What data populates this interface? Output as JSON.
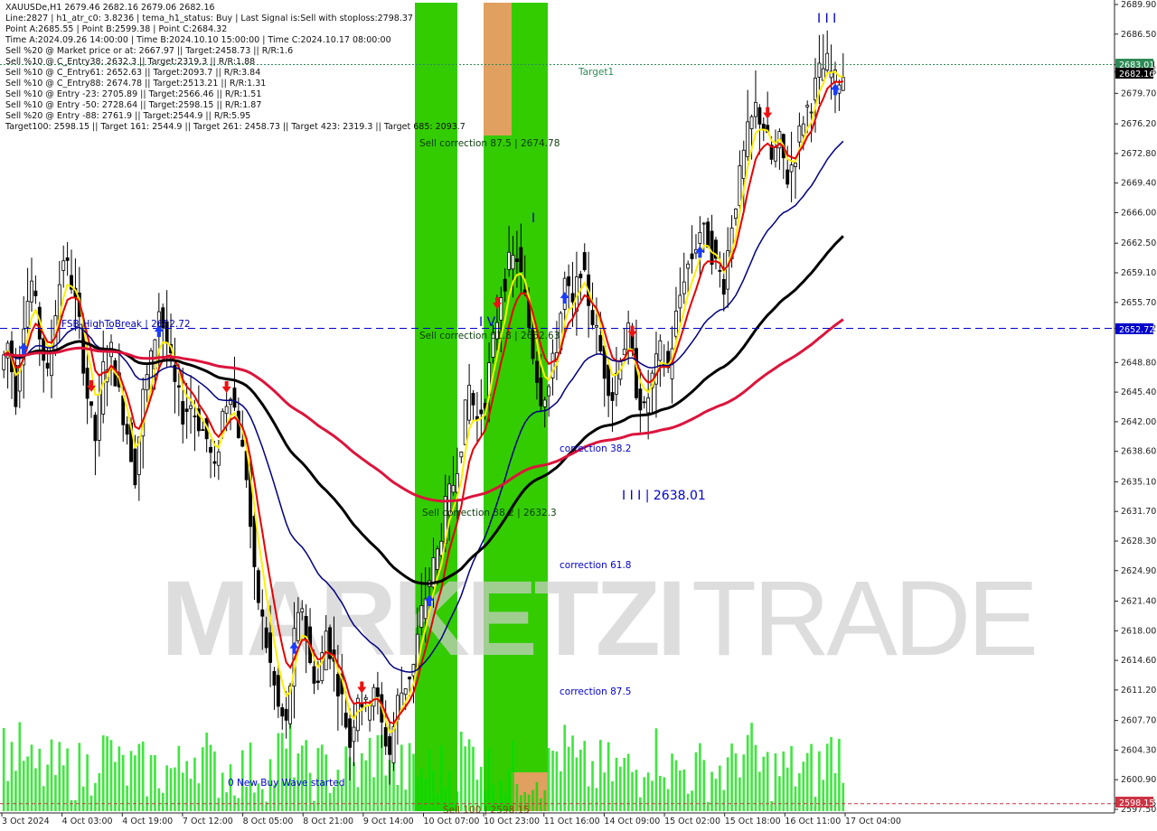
{
  "header": {
    "lines": [
      "XAUUSDe,H1  2679.46 2682.16 2679.06 2682.16",
      "Line:2827 | h1_atr_c0: 3.8236 | tema_h1_status: Buy | Last Signal is:Sell with stoploss:2798.37",
      "Point A:2685.55 | Point B:2599.38 | Point C:2684.32",
      "Time A:2024.09.26 14:00:00 | Time B:2024.10.10 15:00:00 | Time C:2024.10.17 08:00:00",
      "Sell %20 @ Market price or at: 2667.97 || Target:2458.73 || R/R:1.6",
      "Sell %10 @ C_Entry38: 2632.3 || Target:2319.3 || R/R:1.88",
      "Sell %10 @ C_Entry61: 2652.63 || Target:2093.7 || R/R:3.84",
      "Sell %10 @ C_Entry88: 2674.78 || Target:2513.21 || R/R:1.31",
      "Sell %10 @ Entry -23: 2705.89 || Target:2566.46 || R/R:1.51",
      "Sell %10 @ Entry -50: 2728.64 || Target:2598.15 || R/R:1.87",
      "Sell %20 @ Entry -88: 2761.9 || Target:2544.9 || R/R:5.95",
      "Target100: 2598.15 || Target 161: 2544.9 || Target 261: 2458.73 || Target 423: 2319.3 || Target 685: 2093.7"
    ]
  },
  "watermark": {
    "bold": "MARKETZI",
    "light": "TRADE"
  },
  "annotations": {
    "target1": "Target1",
    "sell_875": "Sell correction 87.5 | 2674.78",
    "sell_618": "Sell correction 61.8 | 2652.63",
    "sell_382": "Sell correction 38.2 | 2632.3",
    "sell_100": "Sell 100 | 2598.15",
    "fsb": "FSB-HighToBreak | 2652.72",
    "corr_382": "correction 38.2",
    "corr_618": "correction 61.8",
    "corr_875": "correction 87.5",
    "wave": "0 New Buy Wave started",
    "iii_2638": "I I I | 2638.01",
    "wave_iv": "I V",
    "wave_i": "I",
    "wave_iii_top": "I I I"
  },
  "price_tags": {
    "current": "2682.16",
    "target1": "2683.01",
    "fsb": "2652.72",
    "sell100": "2598.15"
  },
  "colors": {
    "green_zone": "#33cc00",
    "orange_zone": "#e0a060",
    "ema_red": "#e60000",
    "ema_yellow": "#ffee00",
    "ma_navy": "#000080",
    "ma_black": "#000000",
    "ma_crimson": "#dc143c",
    "target_line": "#2e8b57",
    "fsb_line": "#0000cc",
    "sell100_line": "#cc3344",
    "volume": "#00dd00"
  },
  "chart_data": {
    "type": "candlestick",
    "symbol": "XAUUSDe",
    "timeframe": "H1",
    "ylim": [
      2597.5,
      2689.9
    ],
    "y_ticks": [
      "2689.90",
      "2686.50",
      "2683.01",
      "2682.16",
      "2679.70",
      "2676.20",
      "2672.80",
      "2669.40",
      "2666.00",
      "2662.50",
      "2659.10",
      "2655.70",
      "2652.72",
      "2648.80",
      "2645.40",
      "2642.00",
      "2638.60",
      "2635.10",
      "2631.70",
      "2628.30",
      "2624.90",
      "2621.40",
      "2618.00",
      "2614.60",
      "2611.20",
      "2607.70",
      "2604.30",
      "2600.90",
      "2598.15",
      "2597.50"
    ],
    "x_ticks": [
      "3 Oct 2024",
      "4 Oct 03:00",
      "4 Oct 19:00",
      "7 Oct 12:00",
      "8 Oct 05:00",
      "8 Oct 21:00",
      "9 Oct 14:00",
      "10 Oct 07:00",
      "10 Oct 23:00",
      "11 Oct 16:00",
      "14 Oct 09:00",
      "15 Oct 02:00",
      "15 Oct 18:00",
      "16 Oct 11:00",
      "17 Oct 04:00"
    ],
    "price_path": [
      2648,
      2651,
      2645,
      2654,
      2658,
      2652,
      2647,
      2655,
      2661,
      2658,
      2653,
      2645,
      2640,
      2648,
      2650,
      2645,
      2641,
      2636,
      2645,
      2649,
      2655,
      2651,
      2646,
      2643,
      2644,
      2642,
      2640,
      2636,
      2643,
      2646,
      2641,
      2636,
      2624,
      2619,
      2614,
      2609,
      2607,
      2617,
      2621,
      2614,
      2612,
      2618,
      2614,
      2610,
      2605,
      2611,
      2609,
      2612,
      2607,
      2604,
      2610,
      2612,
      2614,
      2620,
      2624,
      2627,
      2632,
      2635,
      2640,
      2646,
      2642,
      2645,
      2651,
      2657,
      2660,
      2661,
      2656,
      2650,
      2645,
      2646,
      2651,
      2658,
      2655,
      2660,
      2656,
      2652,
      2648,
      2645,
      2650,
      2652,
      2646,
      2643,
      2647,
      2650,
      2648,
      2654,
      2659,
      2661,
      2664,
      2663,
      2660,
      2658,
      2665,
      2670,
      2675,
      2678,
      2676,
      2672,
      2674,
      2670,
      2673,
      2677,
      2679,
      2682,
      2683,
      2681,
      2682
    ],
    "fsb_level": 2652.72,
    "target1_level": 2683.01,
    "sell100_level": 2598.15,
    "correction_levels": {
      "38.2": 2632.3,
      "61.8": 2652.63,
      "87.5": 2674.78
    },
    "point_a": 2685.55,
    "point_b": 2599.38,
    "point_c": 2684.32
  }
}
